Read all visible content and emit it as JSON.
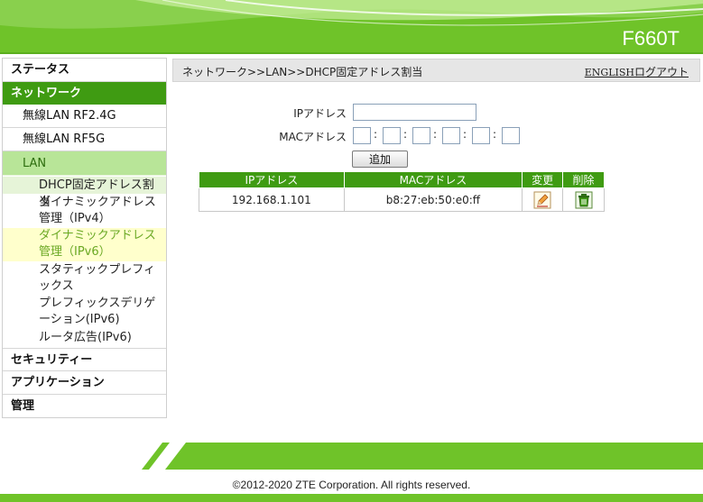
{
  "header": {
    "model": "F660T"
  },
  "sidebar": {
    "items": [
      {
        "label": "ステータス"
      },
      {
        "label": "ネットワーク"
      },
      {
        "label": "無線LAN RF2.4G"
      },
      {
        "label": "無線LAN RF5G"
      },
      {
        "label": "LAN"
      },
      {
        "label": "DHCP固定アドレス割当"
      },
      {
        "label": "ダイナミックアドレス管理（IPv4）"
      },
      {
        "label": "ダイナミックアドレス管理（IPv6）"
      },
      {
        "label": "スタティックプレフィックス"
      },
      {
        "label": "プレフィックスデリゲーション(IPv6)"
      },
      {
        "label": "ルータ広告(IPv6)"
      },
      {
        "label": "セキュリティー"
      },
      {
        "label": "アプリケーション"
      },
      {
        "label": "管理"
      }
    ]
  },
  "breadcrumb": "ネットワーク>>LAN>>DHCP固定アドレス割当",
  "top_links": {
    "english": "ENGLISH",
    "logout": "ログアウト"
  },
  "form": {
    "ip_label": "IPアドレス",
    "ip_value": "",
    "mac_label": "MACアドレス",
    "mac_values": [
      "",
      "",
      "",
      "",
      "",
      ""
    ],
    "mac_separator": ":",
    "add_button": "追加"
  },
  "table": {
    "headers": [
      "IPアドレス",
      "MACアドレス",
      "変更",
      "削除"
    ],
    "rows": [
      {
        "ip": "192.168.1.101",
        "mac": "b8:27:eb:50:e0:ff"
      }
    ]
  },
  "footer": {
    "copyright": "©2012-2020 ZTE Corporation. All rights reserved."
  },
  "colors": {
    "brand_green": "#6fc329",
    "nav_active": "#3f9b12",
    "nav_sub_active": "#b8e598"
  },
  "icons": [
    "edit-icon",
    "trash-icon"
  ]
}
